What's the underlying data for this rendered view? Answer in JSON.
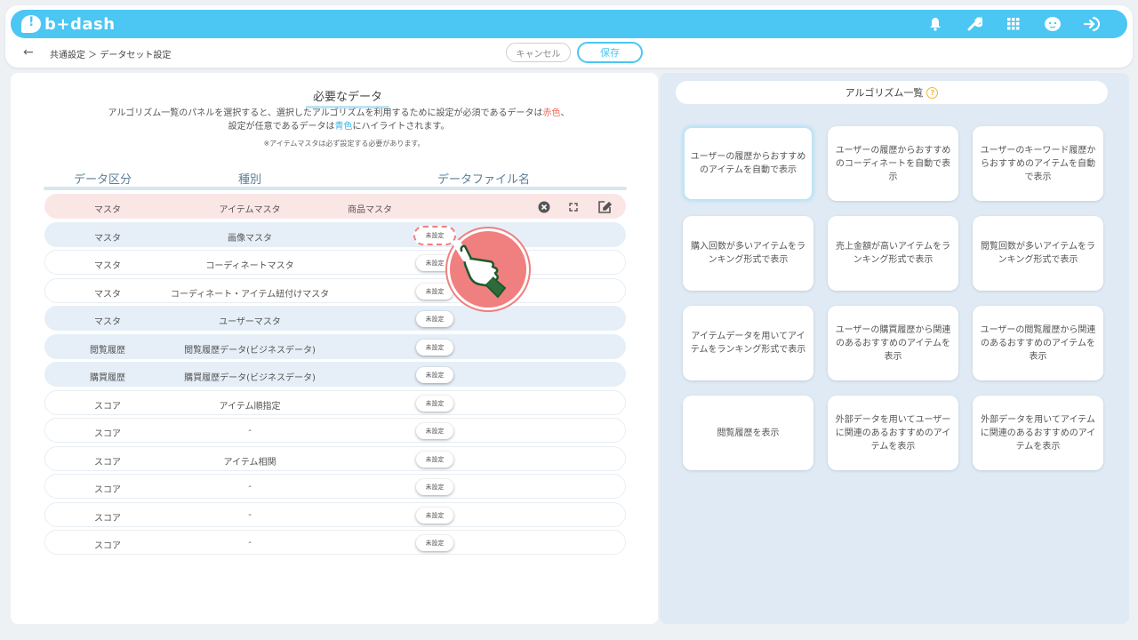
{
  "app": {
    "logo_text": "b+dash"
  },
  "header_icons": [
    "bell-icon",
    "wrench-icon",
    "grid-icon",
    "face-icon",
    "logout-icon"
  ],
  "breadcrumb": {
    "text": "共通設定 ＞ データセット設定"
  },
  "actions": {
    "cancel_label": "キャンセル",
    "save_label": "保存"
  },
  "required": {
    "title": "必要なデータ",
    "desc_line1_a": "アルゴリズム一覧のパネルを選択すると、選択したアルゴリズムを利用するために設定が必須であるデータは",
    "desc_red": "赤色",
    "desc_line1_b": "、",
    "desc_line2_a": "設定が任意であるデータは",
    "desc_blue": "青色",
    "desc_line2_b": "にハイライトされます。",
    "note": "※アイテムマスタは必ず設定する必要があります。"
  },
  "table": {
    "headers": {
      "category": "データ区分",
      "type": "種別",
      "file": "データファイル名"
    },
    "rows": [
      {
        "category": "マスタ",
        "type": "アイテムマスタ",
        "file": "商品マスタ",
        "chip": "",
        "highlight": "pink"
      },
      {
        "category": "マスタ",
        "type": "画像マスタ",
        "file": "",
        "chip": "未設定",
        "highlight": "blue"
      },
      {
        "category": "マスタ",
        "type": "コーディネートマスタ",
        "file": "",
        "chip": "未設定",
        "highlight": ""
      },
      {
        "category": "マスタ",
        "type": "コーディネート・アイテム紐付けマスタ",
        "file": "",
        "chip": "未設定",
        "highlight": ""
      },
      {
        "category": "マスタ",
        "type": "ユーザーマスタ",
        "file": "",
        "chip": "未設定",
        "highlight": "blue"
      },
      {
        "category": "閲覧履歴",
        "type": "閲覧履歴データ(ビジネスデータ)",
        "file": "",
        "chip": "未設定",
        "highlight": "blue"
      },
      {
        "category": "購買履歴",
        "type": "購買履歴データ(ビジネスデータ)",
        "file": "",
        "chip": "未設定",
        "highlight": "blue"
      },
      {
        "category": "スコア",
        "type": "アイテム順指定",
        "file": "",
        "chip": "未設定",
        "highlight": ""
      },
      {
        "category": "スコア",
        "type": "-",
        "file": "",
        "chip": "未設定",
        "highlight": ""
      },
      {
        "category": "スコア",
        "type": "アイテム相関",
        "file": "",
        "chip": "未設定",
        "highlight": ""
      },
      {
        "category": "スコア",
        "type": "-",
        "file": "",
        "chip": "未設定",
        "highlight": ""
      },
      {
        "category": "スコア",
        "type": "-",
        "file": "",
        "chip": "未設定",
        "highlight": ""
      },
      {
        "category": "スコア",
        "type": "-",
        "file": "",
        "chip": "未設定",
        "highlight": ""
      }
    ]
  },
  "algorithms": {
    "title": "アルゴリズム一覧",
    "cards": [
      "ユーザーの履歴からおすすめのアイテムを自動で表示",
      "ユーザーの履歴からおすすめのコーディネートを自動で表示",
      "ユーザーのキーワード履歴からおすすめのアイテムを自動で表示",
      "購入回数が多いアイテムをランキング形式で表示",
      "売上金額が高いアイテムをランキング形式で表示",
      "閲覧回数が多いアイテムをランキング形式で表示",
      "アイテムデータを用いてアイテムをランキング形式で表示",
      "ユーザーの購買履歴から関連のあるおすすめのアイテムを表示",
      "ユーザーの閲覧履歴から関連のあるおすすめのアイテムを表示",
      "閲覧履歴を表示",
      "外部データを用いてユーザーに関連のあるおすすめのアイテムを表示",
      "外部データを用いてアイテムに関連のあるおすすめのアイテムを表示"
    ]
  },
  "colors": {
    "accent": "#4cc6f3",
    "required": "#f16a5a",
    "optional": "#36b6ea"
  }
}
